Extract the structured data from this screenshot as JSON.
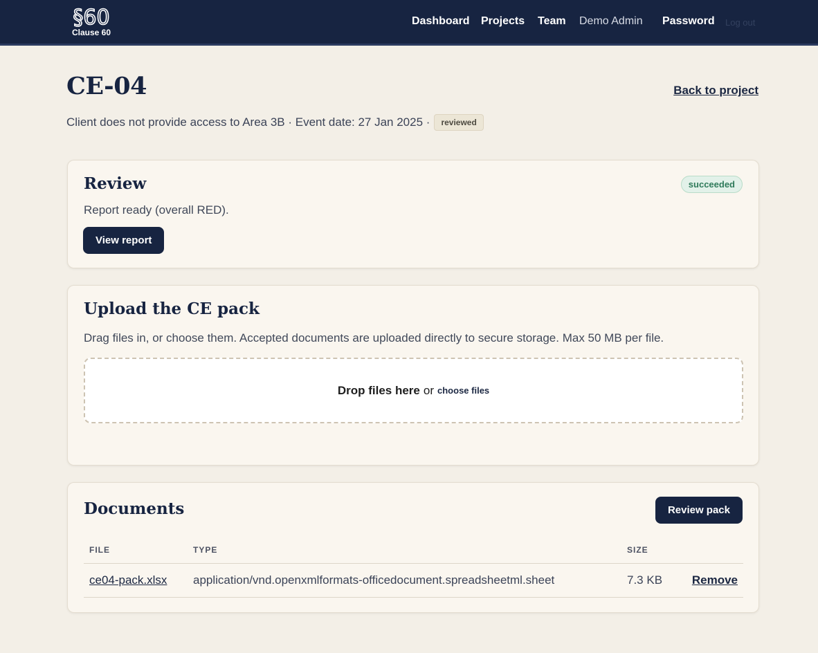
{
  "header": {
    "logo_text": "Clause 60",
    "nav": {
      "dashboard": "Dashboard",
      "projects": "Projects",
      "team": "Team",
      "user": "Demo Admin",
      "password": "Password",
      "logout": "Log out"
    }
  },
  "page": {
    "title": "CE-04",
    "back_link": "Back to project",
    "subtitle": "Client does not provide access to Area 3B · Event date: 27 Jan 2025 ·",
    "status_tag": "reviewed"
  },
  "review": {
    "heading": "Review",
    "status": "succeeded",
    "message": "Report ready (overall RED).",
    "button": "View report"
  },
  "upload": {
    "heading": "Upload the CE pack",
    "description": "Drag files in, or choose them. Accepted documents are uploaded directly to secure storage. Max 50 MB per file.",
    "drop_text": "Drop files here",
    "or_text": "or",
    "choose_text": "choose files"
  },
  "documents": {
    "heading": "Documents",
    "button": "Review pack",
    "columns": {
      "file": "FILE",
      "type": "TYPE",
      "size": "SIZE"
    },
    "rows": [
      {
        "file": "ce04-pack.xlsx",
        "type": "application/vnd.openxmlformats-officedocument.spreadsheetml.sheet",
        "size": "7.3 KB",
        "action": "Remove"
      }
    ]
  },
  "colors": {
    "navy": "#172441",
    "background": "#f3efe7",
    "card": "#faf6ef",
    "success": "#2f7a5a"
  }
}
